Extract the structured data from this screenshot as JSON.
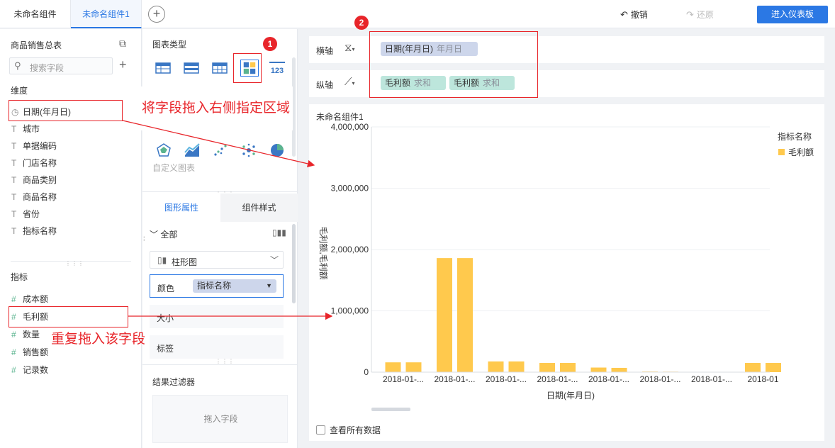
{
  "topbar": {
    "tabs": [
      {
        "label": "未命名组件"
      },
      {
        "label": "未命名组件1"
      }
    ],
    "undo_label": "撤销",
    "redo_label": "还原",
    "enter_dashboard_label": "进入仪表板"
  },
  "left_panel": {
    "dataset_title": "商品销售总表",
    "search_placeholder": "搜索字段",
    "dimension_label": "维度",
    "dimensions": [
      {
        "icon": "clock-icon",
        "label": "日期(年月日)"
      },
      {
        "icon": "text-T-icon",
        "label": "城市"
      },
      {
        "icon": "text-T-icon",
        "label": "单据编码"
      },
      {
        "icon": "text-T-icon",
        "label": "门店名称"
      },
      {
        "icon": "text-T-icon",
        "label": "商品类别"
      },
      {
        "icon": "text-T-icon",
        "label": "商品名称"
      },
      {
        "icon": "text-T-icon",
        "label": "省份"
      },
      {
        "icon": "text-T-icon",
        "label": "指标名称"
      }
    ],
    "measure_label": "指标",
    "measures": [
      {
        "icon": "hash-icon",
        "label": "成本额"
      },
      {
        "icon": "hash-icon",
        "label": "毛利额"
      },
      {
        "icon": "hash-icon",
        "label": "数量"
      },
      {
        "icon": "hash-icon",
        "label": "销售额"
      },
      {
        "icon": "hash-icon",
        "label": "记录数"
      }
    ]
  },
  "type_panel": {
    "title": "图表类型",
    "custom_chart_label": "自定义图表",
    "subtabs": [
      "图形属性",
      "组件样式"
    ],
    "all_label": "全部",
    "chart_select": "柱形图",
    "color_label": "颜色",
    "color_field": "指标名称",
    "size_label": "大小",
    "label_label": "标签",
    "filter_title": "结果过滤器",
    "filter_placeholder": "拖入字段"
  },
  "axes": {
    "x_label": "横轴",
    "y_label": "纵轴",
    "x_pills": [
      {
        "name": "日期(年月日)",
        "agg": "年月日"
      }
    ],
    "y_pills": [
      {
        "name": "毛利额",
        "agg": "求和"
      },
      {
        "name": "毛利额",
        "agg": "求和"
      }
    ]
  },
  "chart_card": {
    "title": "未命名组件1",
    "view_all_label": "查看所有数据"
  },
  "annotations": {
    "badge1": "1",
    "badge2": "2",
    "note1": "将字段拖入右侧指定区域",
    "note2": "重复拖入该字段"
  },
  "colors": {
    "accent": "#2b78e4",
    "bar": "#ffc94d",
    "annotation": "#e8252a"
  },
  "chart_data": {
    "type": "bar",
    "title": "",
    "xlabel": "日期(年月日)",
    "ylabel": "毛利额,毛利额",
    "ylim": [
      0,
      4000000
    ],
    "yticks": [
      "0",
      "1,000,000",
      "2,000,000",
      "3,000,000",
      "4,000,000"
    ],
    "categories": [
      "2018-01-...",
      "2018-01-...",
      "2018-01-...",
      "2018-01-...",
      "2018-01-...",
      "2018-01-...",
      "2018-01-...",
      "2018-01"
    ],
    "legend_title": "指标名称",
    "series": [
      {
        "name": "毛利额",
        "values": [
          160000,
          1860000,
          175000,
          150000,
          75000,
          10000,
          0,
          150000
        ]
      },
      {
        "name": "毛利额",
        "values": [
          160000,
          1860000,
          175000,
          150000,
          70000,
          8000,
          0,
          150000
        ]
      }
    ],
    "grid": true,
    "legend_position": "right"
  }
}
